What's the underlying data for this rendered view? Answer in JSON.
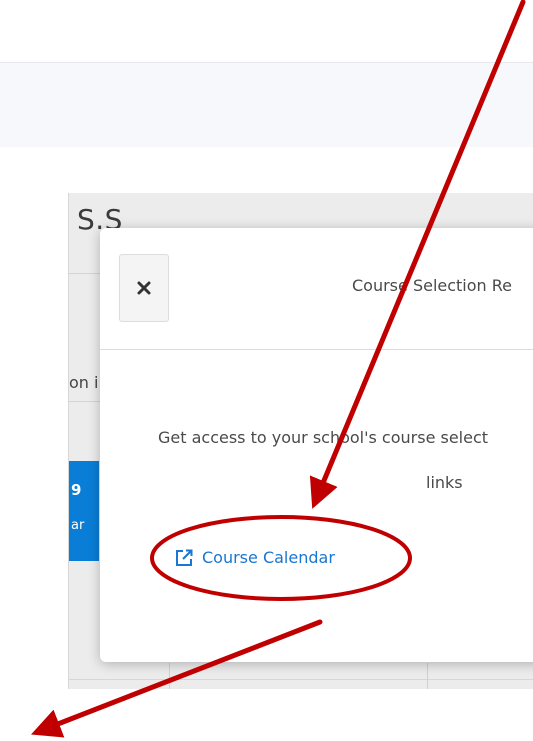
{
  "background": {
    "title": "S.S",
    "row_text": "on i",
    "cell_number": "9",
    "cell_sub": "ar"
  },
  "modal": {
    "close_icon": "close-x-icon",
    "title": "Course Selection Re",
    "description_line1": "Get access to your school's course select",
    "description_line2": "links",
    "link": {
      "icon": "external-link-icon",
      "label": "Course Calendar"
    }
  },
  "colors": {
    "accent": "#1976d2",
    "annotation": "#c00000",
    "blue_cell": "#0a7ed6"
  }
}
